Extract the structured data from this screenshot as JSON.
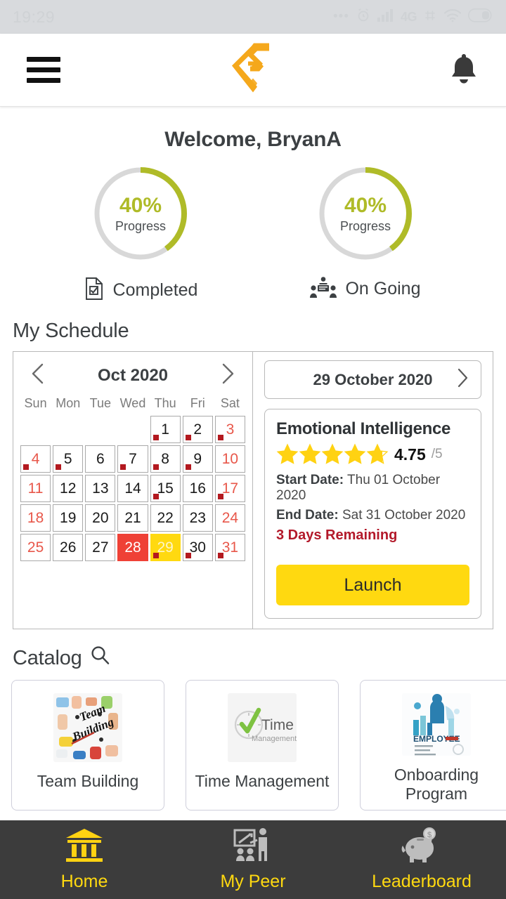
{
  "status_bar": {
    "time": "19:29",
    "icons": [
      "dots-icon",
      "alarm-clock-icon",
      "signal-bars-icon",
      "4g-label",
      "sim-signal-icon",
      "wifi-icon",
      "battery-icon"
    ],
    "network_label": "4G",
    "background": "#d8dadd"
  },
  "header": {
    "menu_icon": "hamburger-menu-icon",
    "logo_icon": "app-logo-icon",
    "notification_icon": "bell-icon",
    "logo_color": "#f5a81c"
  },
  "welcome": {
    "text": "Welcome, BryanA"
  },
  "progress": {
    "accent": "#afbb28",
    "track": "#d8d8d8",
    "cards": [
      {
        "percent_label": "40%",
        "percent_value": 40,
        "sub_label": "Progress",
        "footer_label": "Completed",
        "footer_icon": "document-check-icon"
      },
      {
        "percent_label": "40%",
        "percent_value": 40,
        "sub_label": "Progress",
        "footer_label": "On Going",
        "footer_icon": "meeting-people-icon"
      }
    ]
  },
  "schedule": {
    "section_title": "My Schedule",
    "calendar": {
      "prev_icon": "chevron-left-icon",
      "next_icon": "chevron-right-icon",
      "month_label": "Oct 2020",
      "day_headers": [
        "Sun",
        "Mon",
        "Tue",
        "Wed",
        "Thu",
        "Fri",
        "Sat"
      ],
      "today": 28,
      "selected": 29,
      "today_color": "#ef4136",
      "selected_color": "#ffd910",
      "dot_color": "#b3191f",
      "weekend_color": "#e8574a",
      "weeks": [
        [
          null,
          null,
          null,
          null,
          {
            "d": 1,
            "dot": true
          },
          {
            "d": 2,
            "dot": true
          },
          {
            "d": 3,
            "dot": true,
            "weekend": true
          }
        ],
        [
          {
            "d": 4,
            "dot": true,
            "weekend": true
          },
          {
            "d": 5,
            "dot": true
          },
          {
            "d": 6
          },
          {
            "d": 7,
            "dot": true
          },
          {
            "d": 8,
            "dot": true
          },
          {
            "d": 9,
            "dot": true
          },
          {
            "d": 10,
            "weekend": true
          }
        ],
        [
          {
            "d": 11,
            "weekend": true
          },
          {
            "d": 12
          },
          {
            "d": 13
          },
          {
            "d": 14
          },
          {
            "d": 15,
            "dot": true
          },
          {
            "d": 16
          },
          {
            "d": 17,
            "dot": true,
            "weekend": true
          }
        ],
        [
          {
            "d": 18,
            "weekend": true
          },
          {
            "d": 19
          },
          {
            "d": 20
          },
          {
            "d": 21
          },
          {
            "d": 22
          },
          {
            "d": 23
          },
          {
            "d": 24,
            "weekend": true
          }
        ],
        [
          {
            "d": 25,
            "weekend": true
          },
          {
            "d": 26
          },
          {
            "d": 27
          },
          {
            "d": 28,
            "today": true
          },
          {
            "d": 29,
            "dot": true,
            "selected": true
          },
          {
            "d": 30,
            "dot": true
          },
          {
            "d": 31,
            "dot": true,
            "weekend": true
          }
        ]
      ]
    },
    "date_picker": {
      "value": "29 October 2020",
      "next_icon": "chevron-right-icon"
    },
    "event": {
      "title": "Emotional Intelligence",
      "rating_value": 4.75,
      "rating_label": "4.75",
      "rating_max_label": "/5",
      "star_color": "#ffd212",
      "start_label": "Start Date:",
      "start_value": "Thu 01 October 2020",
      "end_label": "End Date:",
      "end_value": "Sat 31 October 2020",
      "remaining": "3 Days Remaining",
      "remaining_color": "#b3192a",
      "launch_label": "Launch",
      "launch_color": "#ffd910"
    }
  },
  "catalog": {
    "section_title": "Catalog",
    "search_icon": "search-icon",
    "items": [
      {
        "name": "Team Building",
        "thumb": "team-building-collage-thumbnail"
      },
      {
        "name": "Time Management",
        "thumb": "time-management-logo-thumbnail"
      },
      {
        "name": "Onboarding Program",
        "thumb": "onboarding-employee-infographic-thumbnail"
      }
    ]
  },
  "bottom_nav": {
    "background": "#3c3c3c",
    "active_color": "#ffd910",
    "inactive_color": "#bdbdbd",
    "items": [
      {
        "label": "Home",
        "icon": "bank-building-icon",
        "active": true
      },
      {
        "label": "My Peer",
        "icon": "presentation-trainer-icon",
        "active": false
      },
      {
        "label": "Leaderboard",
        "icon": "piggy-bank-icon",
        "active": false
      }
    ]
  }
}
